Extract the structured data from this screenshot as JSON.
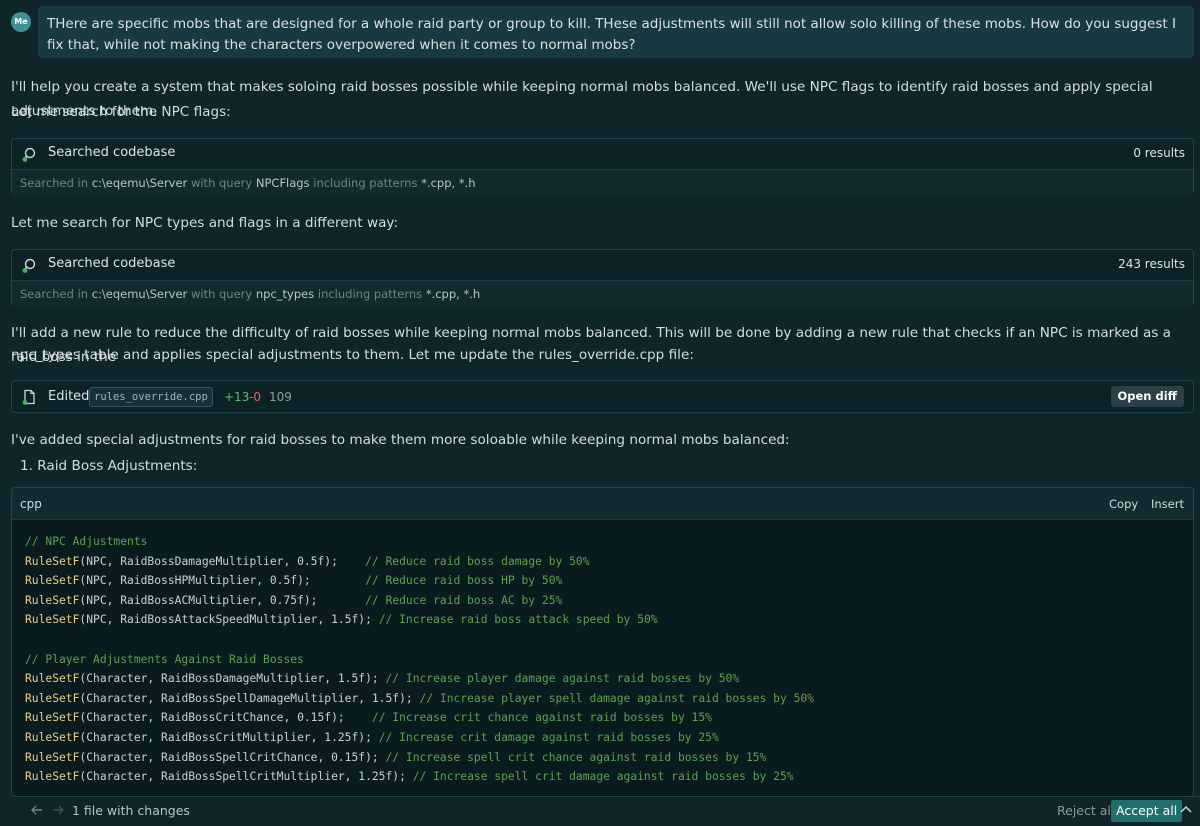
{
  "user": {
    "avatar_label": "Me",
    "message": "THere are specific mobs that are designed for a whole raid party or group to kill. THese adjustments will still not allow solo killing of these mobs. How do you suggest I fix that, while not making the characters overpowered when it comes to normal mobs?"
  },
  "assistant": {
    "intro_line1": "I'll help you create a system that makes soloing raid bosses possible while keeping normal mobs balanced. We'll use NPC flags to identify raid bosses and apply special adjustments to them.",
    "intro_line2": "Let me search for the NPC flags:",
    "search2_lead": "Let me search for NPC types and flags in a different way:",
    "rule_para_line1": "I'll add a new rule to reduce the difficulty of raid bosses while keeping normal mobs balanced. This will be done by adding a new rule that checks if an NPC is marked as a raid boss in the",
    "rule_para_line2": "npc_types table and applies special adjustments to them. Let me update the rules_override.cpp file:",
    "summary": "I've added special adjustments for raid bosses to make them more soloable while keeping normal mobs balanced:",
    "list_item": "1.  Raid Boss Adjustments:"
  },
  "searches": [
    {
      "title": "Searched codebase",
      "count": "0 results",
      "prefix": "Searched in",
      "path": "c:\\eqemu\\Server",
      "query_label": "with query",
      "query": "NPCFlags",
      "pattern_label": "including patterns",
      "patterns": "*.cpp, *.h"
    },
    {
      "title": "Searched codebase",
      "count": "243 results",
      "prefix": "Searched in",
      "path": "c:\\eqemu\\Server",
      "query_label": "with query",
      "query": "npc_types",
      "pattern_label": "including patterns",
      "patterns": "*.cpp, *.h"
    }
  ],
  "edit": {
    "label": "Edited",
    "file": "rules_override.cpp",
    "added": "+13",
    "removed": "-0",
    "lines": "109",
    "open_diff": "Open diff"
  },
  "code": {
    "lang": "cpp",
    "copy": "Copy",
    "insert": "Insert",
    "lines": [
      {
        "fn": "",
        "args": "",
        "comment": "// NPC Adjustments"
      },
      {
        "fn": "RuleSetF",
        "args": "(NPC, RaidBossDamageMultiplier, 0.5f);    ",
        "comment": "// Reduce raid boss damage by 50%"
      },
      {
        "fn": "RuleSetF",
        "args": "(NPC, RaidBossHPMultiplier, 0.5f);        ",
        "comment": "// Reduce raid boss HP by 50%"
      },
      {
        "fn": "RuleSetF",
        "args": "(NPC, RaidBossACMultiplier, 0.75f);       ",
        "comment": "// Reduce raid boss AC by 25%"
      },
      {
        "fn": "RuleSetF",
        "args": "(NPC, RaidBossAttackSpeedMultiplier, 1.5f); ",
        "comment": "// Increase raid boss attack speed by 50%"
      },
      {
        "fn": "",
        "args": "",
        "comment": ""
      },
      {
        "fn": "",
        "args": "",
        "comment": "// Player Adjustments Against Raid Bosses"
      },
      {
        "fn": "RuleSetF",
        "args": "(Character, RaidBossDamageMultiplier, 1.5f); ",
        "comment": "// Increase player damage against raid bosses by 50%"
      },
      {
        "fn": "RuleSetF",
        "args": "(Character, RaidBossSpellDamageMultiplier, 1.5f); ",
        "comment": "// Increase player spell damage against raid bosses by 50%"
      },
      {
        "fn": "RuleSetF",
        "args": "(Character, RaidBossCritChance, 0.15f);    ",
        "comment": "// Increase crit chance against raid bosses by 15%"
      },
      {
        "fn": "RuleSetF",
        "args": "(Character, RaidBossCritMultiplier, 1.25f); ",
        "comment": "// Increase crit damage against raid bosses by 25%"
      },
      {
        "fn": "RuleSetF",
        "args": "(Character, RaidBossSpellCritChance, 0.15f); ",
        "comment": "// Increase spell crit chance against raid bosses by 15%"
      },
      {
        "fn": "RuleSetF",
        "args": "(Character, RaidBossSpellCritMultiplier, 1.25f); ",
        "comment": "// Increase spell crit damage against raid bosses by 25%"
      }
    ]
  },
  "bottom_bar": {
    "back_icon": "arrow-left-icon",
    "forward_icon": "arrow-right-icon",
    "changes": "1 file with changes",
    "reject": "Reject all",
    "accept": "Accept all",
    "chevron_icon": "chevron-up-icon"
  },
  "colors": {
    "background": "#0f2529",
    "keyword": "#e6cf86",
    "comment": "#5fa04e",
    "added": "#5cc26a",
    "removed": "#e4605a",
    "accept_button": "#1f6f6a"
  }
}
